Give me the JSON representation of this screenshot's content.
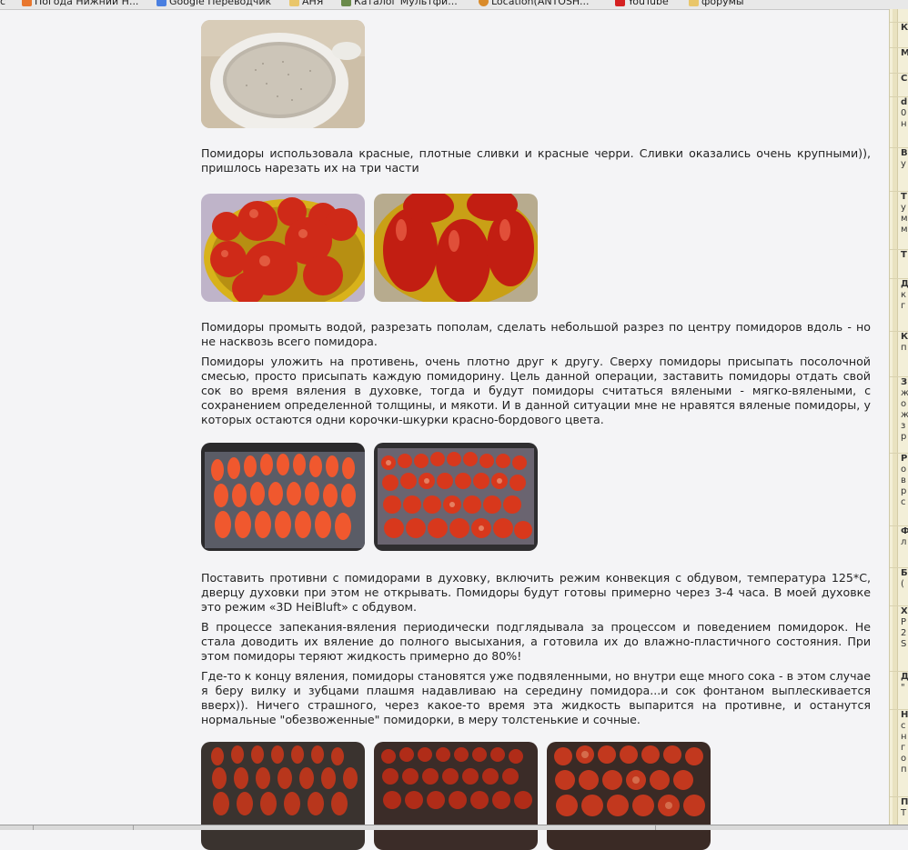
{
  "bookmarks": [
    {
      "label": "Погода Нижний Н...",
      "icon": "weather-icon"
    },
    {
      "label": "Google Переводчик",
      "icon": "translate-icon"
    },
    {
      "label": "АНЯ",
      "icon": "folder-icon"
    },
    {
      "label": "Каталог Мультфи...",
      "icon": "catalog-icon"
    },
    {
      "label": "Location(ANTOSH...",
      "icon": "location-icon"
    },
    {
      "label": "YouTube",
      "icon": "youtube-icon"
    },
    {
      "label": "форумы",
      "icon": "folder-icon"
    }
  ],
  "article": {
    "p1": "Помидоры использовала красные, плотные сливки и красные черри. Сливки оказались очень крупными)), пришлось нарезать их на три части",
    "p2": "Помидоры промыть водой, разрезать пополам, сделать небольшой разрез по центру помидоров вдоль  - но не насквозь всего помидора.",
    "p3": "Помидоры уложить на противень, очень плотно друг к другу. Сверху помидоры присыпать посолочной смесью, просто присыпать каждую помидорину. Цель данной операции, заставить помидоры отдать свой сок во время вяления в духовке, тогда и будут помидоры считаться вялеными - мягко-вялеными, с сохранением определенной толщины, и мякоти.  И в данной ситуации мне не нравятся вяленые помидоры, у которых остаются одни корочки-шкурки красно-бордового цвета.",
    "p4": "Поставить противни с помидорами в духовку, включить режим конвекция с обдувом, температура 125*С, дверцу духовки при этом не открывать. Помидоры будут готовы примерно через 3-4 часа. В моей духовке это режим «3D HeiBluft» с обдувом.",
    "p5": "В процессе запекания-вяления периодически подглядывала за процессом и поведением помидорок. Не стала доводить их вяление до полного высыхания, а готовила их до влажно-пластичного состояния. При этом помидоры теряют жидкость примерно до 80%!",
    "p6": "Где-то к концу вяления, помидоры становятся уже подвяленными, но внутри еще много сока - в этом случае я беру вилку и зубцами плашмя надавливаю на середину помидора...и сок фонтаном выплескивается вверх)). Ничего страшного, через какое-то время эта жидкость выпарится на противне, и останутся нормальные \"обезвоженные\" помидорки, в меру толстенькие и сочные."
  },
  "sidebar_letters": [
    [
      "К"
    ],
    [
      "М"
    ],
    [
      "С"
    ],
    [
      "d",
      "0",
      "н"
    ],
    [
      "В",
      "у"
    ],
    [
      "Т",
      "у",
      "м",
      "м"
    ],
    [
      "Т"
    ],
    [
      "Д",
      "к",
      "г"
    ],
    [
      "К",
      "п"
    ],
    [
      "З",
      "ж",
      "о",
      "ж",
      "з",
      "р"
    ],
    [
      "Р",
      "о",
      "в",
      "р",
      "с"
    ],
    [
      "Ф",
      "л"
    ],
    [
      "Б",
      "("
    ],
    [
      "Х",
      "Р",
      "2",
      "S"
    ],
    [
      "Д",
      "\""
    ],
    [
      "Н",
      "с",
      "н",
      "г",
      "о",
      "п"
    ],
    [
      "П",
      "Т"
    ]
  ],
  "colors": {
    "page_bg": "#f4f4f6",
    "text": "#222222",
    "sidebar_bg": "#f3efd8"
  }
}
